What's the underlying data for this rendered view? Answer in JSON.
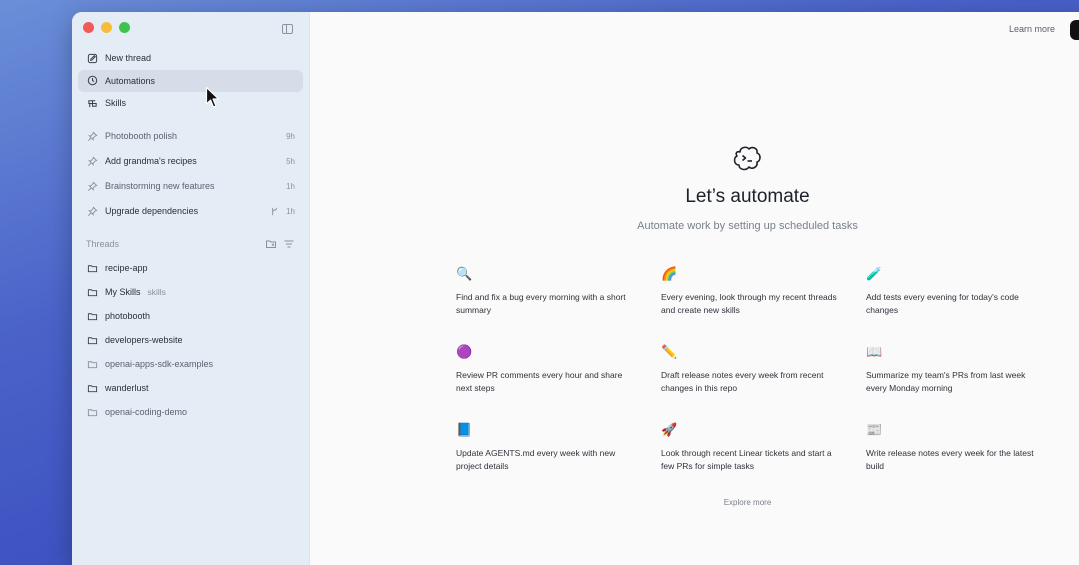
{
  "sidebar": {
    "primary": [
      {
        "label": "New thread",
        "icon": "edit-icon"
      },
      {
        "label": "Automations",
        "icon": "clock-icon"
      },
      {
        "label": "Skills",
        "icon": "skills-icon"
      }
    ],
    "pinned": [
      {
        "label": "Photobooth polish",
        "meta": "9h"
      },
      {
        "label": "Add grandma's recipes",
        "meta": "5h"
      },
      {
        "label": "Brainstorming new features",
        "meta": "1h"
      },
      {
        "label": "Upgrade dependencies",
        "meta": "1h"
      }
    ],
    "threads_header": "Threads",
    "threads": [
      {
        "label": "recipe-app",
        "sub": ""
      },
      {
        "label": "My Skills",
        "sub": "skills"
      },
      {
        "label": "photobooth",
        "sub": ""
      },
      {
        "label": "developers-website",
        "sub": ""
      },
      {
        "label": "openai-apps-sdk-examples",
        "sub": ""
      },
      {
        "label": "wanderlust",
        "sub": ""
      },
      {
        "label": "openai-coding-demo",
        "sub": ""
      }
    ]
  },
  "header": {
    "learn_more": "Learn more"
  },
  "hero": {
    "title": "Let’s automate",
    "subtitle": "Automate work by setting up scheduled tasks"
  },
  "cards": [
    {
      "emoji": "🔍",
      "text": "Find and fix a bug every morning with a short summary"
    },
    {
      "emoji": "🌈",
      "text": "Every evening, look through my recent threads and create new skills"
    },
    {
      "emoji": "🧪",
      "text": "Add tests every evening for today's code changes"
    },
    {
      "emoji": "🟣",
      "text": "Review PR comments every hour and share next steps"
    },
    {
      "emoji": "✏️",
      "text": "Draft release notes every week from recent changes in this repo"
    },
    {
      "emoji": "📖",
      "text": "Summarize my team's PRs from last week every Monday morning"
    },
    {
      "emoji": "📘",
      "text": "Update AGENTS.md every week with new project details"
    },
    {
      "emoji": "🚀",
      "text": "Look through recent Linear tickets and start a few PRs for simple tasks"
    },
    {
      "emoji": "📰",
      "text": "Write release notes every week for the latest build"
    }
  ],
  "explore_more": "Explore more"
}
